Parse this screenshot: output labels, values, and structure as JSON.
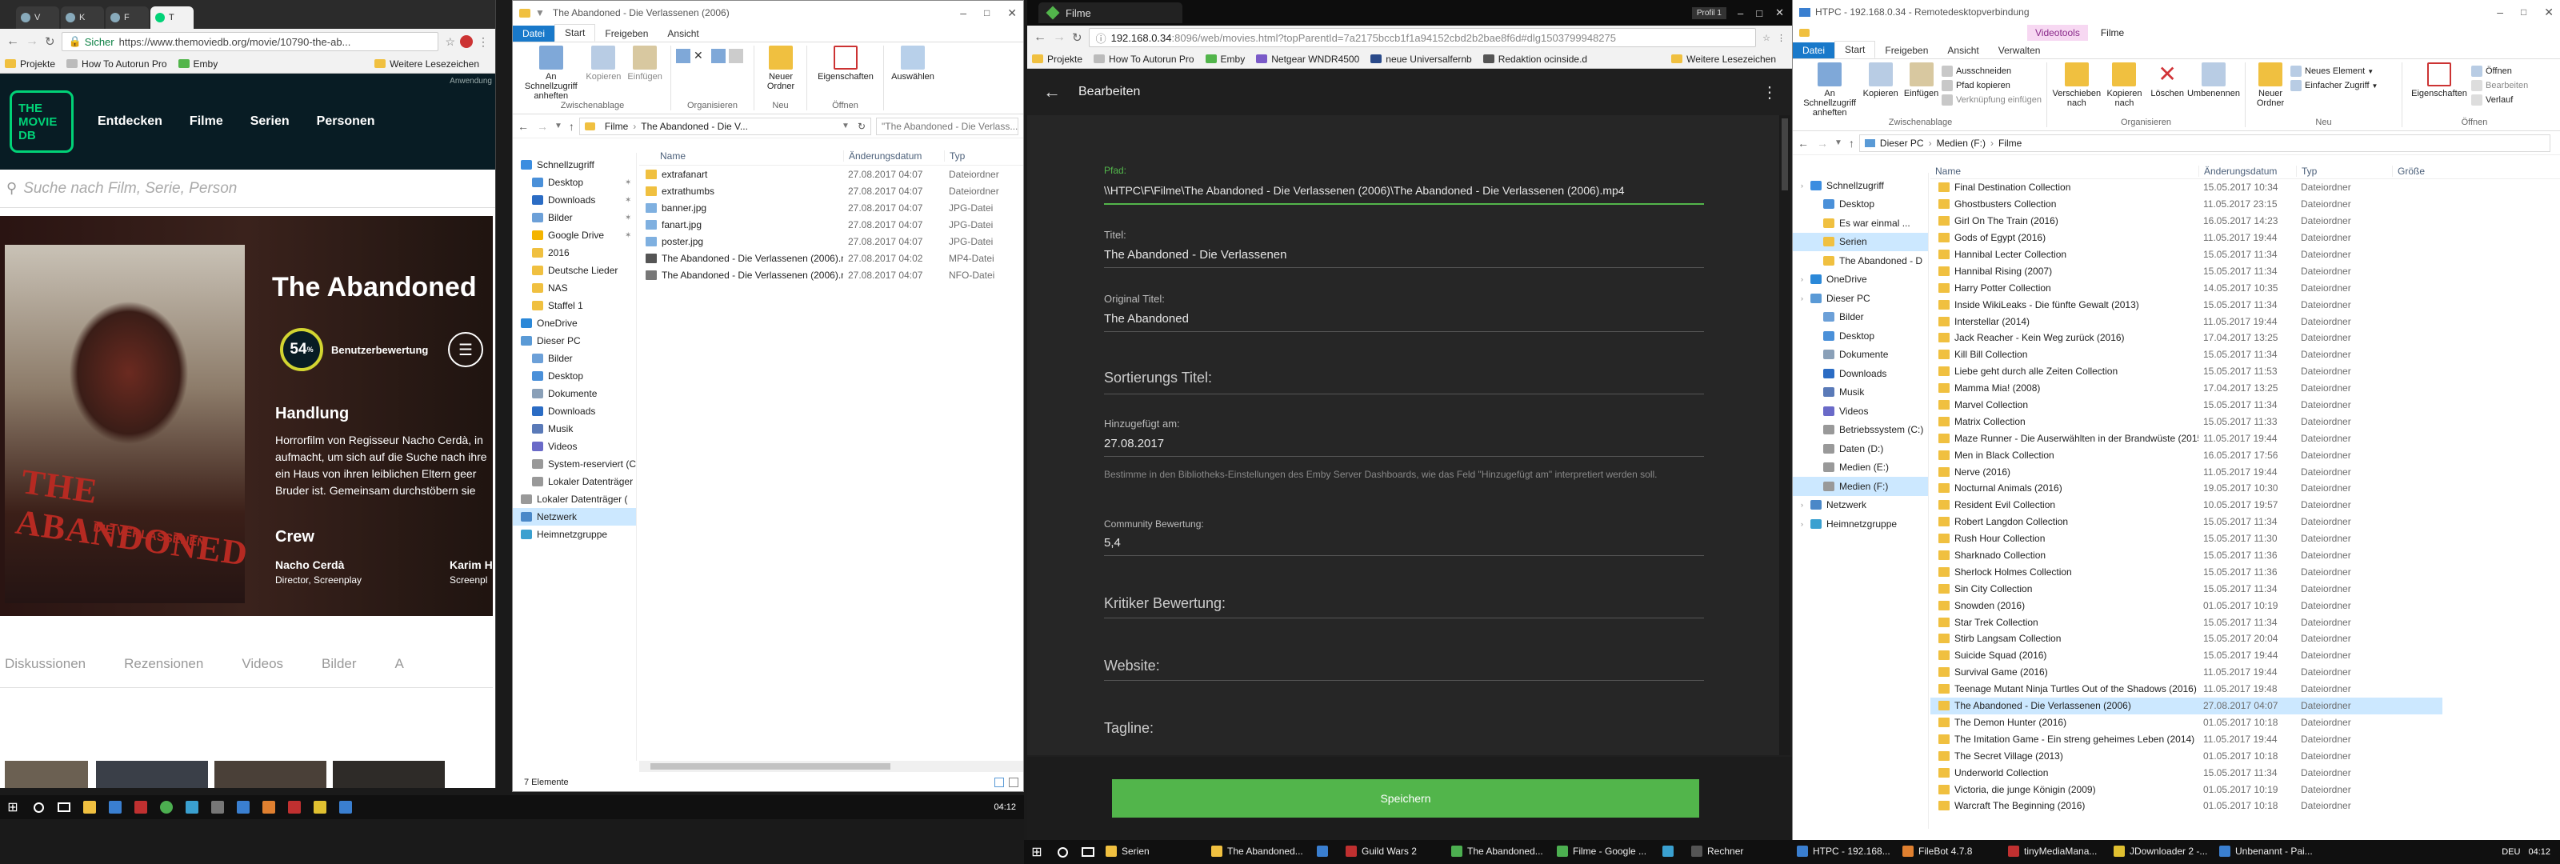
{
  "left_screen": {
    "taskbar": {
      "clock": "04:12"
    }
  },
  "chrome_left": {
    "tabs": [
      "V",
      "K",
      "F",
      "T"
    ],
    "active_tab": "T",
    "url": "https://www.themoviedb.org/movie/10790-the-ab...",
    "secure_label": "Sicher",
    "bookmarks": [
      "Projekte",
      "How To Autorun Pro",
      "Emby"
    ],
    "bookmarks_more": "Weitere Lesezeichen",
    "tmdb": {
      "logo_lines": [
        "THE",
        "MOVIE",
        "DB"
      ],
      "hint": "Anwendung",
      "nav": [
        "Entdecken",
        "Filme",
        "Serien",
        "Personen"
      ],
      "search_placeholder": "Suche nach Film, Serie, Person",
      "title": "The Abandoned",
      "score": "54",
      "score_suffix": "%",
      "score_label": "Benutzerbewertung",
      "plot_heading": "Handlung",
      "plot_text": "Horrorfilm von Regisseur Nacho Cerdà, in aufmacht, um sich auf die Suche nach ihre ein Haus von ihren leiblichen Eltern geer Bruder ist. Gemeinsam durchstöbern sie",
      "poster_title": "THE ABANDONED",
      "poster_sub": "DIE VERLASSENEN",
      "crew_heading": "Crew",
      "crew": [
        {
          "name": "Nacho Cerdà",
          "role": "Director, Screenplay"
        },
        {
          "name": "Karim H",
          "role": "Screenpl"
        }
      ],
      "media_tabs": [
        "Diskussionen",
        "Rezensionen",
        "Videos",
        "Bilder",
        "A"
      ]
    }
  },
  "explorer_left": {
    "title": "The Abandoned - Die Verlassenen (2006)",
    "ribbon_tabs": [
      "Datei",
      "Start",
      "Freigeben",
      "Ansicht"
    ],
    "active_ribbon_tab": "Start",
    "ribbon": {
      "pin_label": "An Schnellzugriff anheften",
      "copy": "Kopieren",
      "paste": "Einfügen",
      "clipboard": "Zwischenablage",
      "organize": "Organisieren",
      "new_folder": "Neuer Ordner",
      "new": "Neu",
      "properties": "Eigenschaften",
      "open": "Öffnen",
      "select": "Auswählen"
    },
    "breadcrumb": [
      "Filme",
      "The Abandoned - Die V..."
    ],
    "search_placeholder": "\"The Abandoned - Die Verlass...",
    "nav": [
      {
        "label": "Schnellzugriff",
        "indent": 0,
        "color": "#3b8de0",
        "pin": false
      },
      {
        "label": "Desktop",
        "indent": 1,
        "color": "#4a90d9",
        "pin": true
      },
      {
        "label": "Downloads",
        "indent": 1,
        "color": "#2b6cc4",
        "pin": true
      },
      {
        "label": "Bilder",
        "indent": 1,
        "color": "#6ca0d8",
        "pin": true
      },
      {
        "label": "Google Drive",
        "indent": 1,
        "color": "#f4b400",
        "pin": true
      },
      {
        "label": "2016",
        "indent": 1,
        "color": "#f0c040",
        "pin": false
      },
      {
        "label": "Deutsche Lieder",
        "indent": 1,
        "color": "#f0c040",
        "pin": false
      },
      {
        "label": "NAS",
        "indent": 1,
        "color": "#f0c040",
        "pin": false
      },
      {
        "label": "Staffel 1",
        "indent": 1,
        "color": "#f0c040",
        "pin": false
      },
      {
        "label": "OneDrive",
        "indent": 0,
        "color": "#2b88d8",
        "pin": false
      },
      {
        "label": "Dieser PC",
        "indent": 0,
        "color": "#5a9ad6",
        "pin": false
      },
      {
        "label": "Bilder",
        "indent": 1,
        "color": "#6ca0d8",
        "pin": false
      },
      {
        "label": "Desktop",
        "indent": 1,
        "color": "#4a90d9",
        "pin": false
      },
      {
        "label": "Dokumente",
        "indent": 1,
        "color": "#8aa0b8",
        "pin": false
      },
      {
        "label": "Downloads",
        "indent": 1,
        "color": "#2b6cc4",
        "pin": false
      },
      {
        "label": "Musik",
        "indent": 1,
        "color": "#5a7ab8",
        "pin": false
      },
      {
        "label": "Videos",
        "indent": 1,
        "color": "#6a6ac8",
        "pin": false
      },
      {
        "label": "System-reserviert (C",
        "indent": 1,
        "color": "#999999",
        "pin": false
      },
      {
        "label": "Lokaler Datenträger",
        "indent": 1,
        "color": "#999999",
        "pin": false
      },
      {
        "label": "Lokaler Datenträger (",
        "indent": 0,
        "color": "#999999",
        "pin": false
      },
      {
        "label": "Netzwerk",
        "indent": 0,
        "color": "#4a88c8",
        "pin": false,
        "selected": true
      },
      {
        "label": "Heimnetzgruppe",
        "indent": 0,
        "color": "#3aa0d0",
        "pin": false
      }
    ],
    "columns": [
      "Name",
      "Änderungsdatum",
      "Typ"
    ],
    "files": [
      {
        "name": "extrafanart",
        "date": "27.08.2017 04:07",
        "type": "Dateiordner",
        "color": "#f0c040"
      },
      {
        "name": "extrathumbs",
        "date": "27.08.2017 04:07",
        "type": "Dateiordner",
        "color": "#f0c040"
      },
      {
        "name": "banner.jpg",
        "date": "27.08.2017 04:07",
        "type": "JPG-Datei",
        "color": "#7fb0e0"
      },
      {
        "name": "fanart.jpg",
        "date": "27.08.2017 04:07",
        "type": "JPG-Datei",
        "color": "#7fb0e0"
      },
      {
        "name": "poster.jpg",
        "date": "27.08.2017 04:07",
        "type": "JPG-Datei",
        "color": "#7fb0e0"
      },
      {
        "name": "The Abandoned - Die Verlassenen (2006).mp4",
        "date": "27.08.2017 04:02",
        "type": "MP4-Datei",
        "color": "#555555"
      },
      {
        "name": "The Abandoned - Die Verlassenen (2006).nfo",
        "date": "27.08.2017 04:07",
        "type": "NFO-Datei",
        "color": "#777777"
      }
    ],
    "status": "7 Elemente"
  },
  "emby": {
    "window_title": "Filme",
    "url_host": "192.168.0.34",
    "url_rest": ":8096/web/movies.html?topParentId=7a2175bccb1f1a94152cbd2b2bae8f6d#dlg1503799948275",
    "bookmarks": [
      "Projekte",
      "How To Autorun Pro",
      "Emby",
      "Netgear WNDR4500",
      "neue Universalfernb",
      "Redaktion ocinside.d"
    ],
    "bookmarks_more": "Weitere Lesezeichen",
    "header_title": "Bearbeiten",
    "profile": "Profil 1",
    "fields": {
      "path_label": "Pfad:",
      "path_value": "\\\\HTPC\\F\\Filme\\The Abandoned - Die Verlassenen (2006)\\The Abandoned - Die Verlassenen (2006).mp4",
      "title_label": "Titel:",
      "title_value": "The Abandoned - Die Verlassenen",
      "orig_label": "Original Titel:",
      "orig_value": "The Abandoned",
      "sort_label": "Sortierungs Titel:",
      "added_label": "Hinzugefügt am:",
      "added_value": "27.08.2017",
      "added_help": "Bestimme in den Bibliotheks-Einstellungen des Emby Server Dashboards, wie das Feld \"Hinzugefügt am\" interpretiert werden soll.",
      "community_label": "Community Bewertung:",
      "community_value": "5,4",
      "critic_label": "Kritiker Bewertung:",
      "website_label": "Website:",
      "tagline_label": "Tagline:"
    },
    "save_button": "Speichern"
  },
  "explorer_right": {
    "title": "HTPC - 192.168.0.34 - Remotedesktopverbindung",
    "context_tab": "Videotools",
    "context_title": "Filme",
    "ribbon_tabs": [
      "Datei",
      "Start",
      "Freigeben",
      "Ansicht",
      "Verwalten"
    ],
    "active_ribbon_tab": "Start",
    "ribbon": {
      "pin_label": "An Schnellzugriff anheften",
      "copy": "Kopieren",
      "paste": "Einfügen",
      "cut": "Ausschneiden",
      "copy_path": "Pfad kopieren",
      "paste_link": "Verknüpfung einfügen",
      "clipboard": "Zwischenablage",
      "move": "Verschieben nach",
      "copyto": "Kopieren nach",
      "delete": "Löschen",
      "rename": "Umbenennen",
      "organize": "Organisieren",
      "new_folder": "Neuer Ordner",
      "new_element": "Neues Element",
      "easy_access": "Einfacher Zugriff",
      "new": "Neu",
      "properties": "Eigenschaften",
      "open": "Öffnen",
      "edit": "Bearbeiten",
      "history": "Verlauf",
      "open_group": "Öffnen"
    },
    "breadcrumb": [
      "Dieser PC",
      "Medien (F:)",
      "Filme"
    ],
    "nav": [
      {
        "label": "Schnellzugriff",
        "indent": 0,
        "color": "#3b8de0"
      },
      {
        "label": "Desktop",
        "indent": 1,
        "color": "#4a90d9"
      },
      {
        "label": "Es war einmal ...",
        "indent": 1,
        "color": "#f0c040"
      },
      {
        "label": "Serien",
        "indent": 1,
        "color": "#f0c040",
        "selected": true
      },
      {
        "label": "The Abandoned - D",
        "indent": 1,
        "color": "#f0c040"
      },
      {
        "label": "OneDrive",
        "indent": 0,
        "color": "#2b88d8"
      },
      {
        "label": "Dieser PC",
        "indent": 0,
        "color": "#5a9ad6"
      },
      {
        "label": "Bilder",
        "indent": 1,
        "color": "#6ca0d8"
      },
      {
        "label": "Desktop",
        "indent": 1,
        "color": "#4a90d9"
      },
      {
        "label": "Dokumente",
        "indent": 1,
        "color": "#8aa0b8"
      },
      {
        "label": "Downloads",
        "indent": 1,
        "color": "#2b6cc4"
      },
      {
        "label": "Musik",
        "indent": 1,
        "color": "#5a7ab8"
      },
      {
        "label": "Videos",
        "indent": 1,
        "color": "#6a6ac8"
      },
      {
        "label": "Betriebssystem (C:)",
        "indent": 1,
        "color": "#999999"
      },
      {
        "label": "Daten (D:)",
        "indent": 1,
        "color": "#999999"
      },
      {
        "label": "Medien (E:)",
        "indent": 1,
        "color": "#999999"
      },
      {
        "label": "Medien (F:)",
        "indent": 1,
        "color": "#999999",
        "selected": true
      },
      {
        "label": "Netzwerk",
        "indent": 0,
        "color": "#4a88c8"
      },
      {
        "label": "Heimnetzgruppe",
        "indent": 0,
        "color": "#3aa0d0"
      }
    ],
    "columns": [
      "Name",
      "Änderungsdatum",
      "Typ",
      "Größe"
    ],
    "files": [
      {
        "name": "Final Destination Collection",
        "date": "15.05.2017 10:34",
        "type": "Dateiordner"
      },
      {
        "name": "Ghostbusters Collection",
        "date": "11.05.2017 23:15",
        "type": "Dateiordner"
      },
      {
        "name": "Girl On The Train (2016)",
        "date": "16.05.2017 14:23",
        "type": "Dateiordner"
      },
      {
        "name": "Gods of Egypt (2016)",
        "date": "11.05.2017 19:44",
        "type": "Dateiordner"
      },
      {
        "name": "Hannibal Lecter Collection",
        "date": "15.05.2017 11:34",
        "type": "Dateiordner"
      },
      {
        "name": "Hannibal Rising (2007)",
        "date": "15.05.2017 11:34",
        "type": "Dateiordner"
      },
      {
        "name": "Harry Potter Collection",
        "date": "14.05.2017 10:35",
        "type": "Dateiordner"
      },
      {
        "name": "Inside WikiLeaks - Die fünfte Gewalt (2013)",
        "date": "15.05.2017 11:34",
        "type": "Dateiordner"
      },
      {
        "name": "Interstellar (2014)",
        "date": "11.05.2017 19:44",
        "type": "Dateiordner"
      },
      {
        "name": "Jack Reacher - Kein Weg zurück (2016)",
        "date": "17.04.2017 13:25",
        "type": "Dateiordner"
      },
      {
        "name": "Kill Bill Collection",
        "date": "15.05.2017 11:34",
        "type": "Dateiordner"
      },
      {
        "name": "Liebe geht durch alle Zeiten Collection",
        "date": "15.05.2017 11:53",
        "type": "Dateiordner"
      },
      {
        "name": "Mamma Mia! (2008)",
        "date": "17.04.2017 13:25",
        "type": "Dateiordner"
      },
      {
        "name": "Marvel Collection",
        "date": "15.05.2017 11:34",
        "type": "Dateiordner"
      },
      {
        "name": "Matrix Collection",
        "date": "15.05.2017 11:33",
        "type": "Dateiordner"
      },
      {
        "name": "Maze Runner - Die Auserwählten in der Brandwüste (2015)",
        "date": "11.05.2017 19:44",
        "type": "Dateiordner"
      },
      {
        "name": "Men in Black Collection",
        "date": "16.05.2017 17:56",
        "type": "Dateiordner"
      },
      {
        "name": "Nerve (2016)",
        "date": "11.05.2017 19:44",
        "type": "Dateiordner"
      },
      {
        "name": "Nocturnal Animals (2016)",
        "date": "19.05.2017 10:30",
        "type": "Dateiordner"
      },
      {
        "name": "Resident Evil Collection",
        "date": "10.05.2017 19:57",
        "type": "Dateiordner"
      },
      {
        "name": "Robert Langdon Collection",
        "date": "15.05.2017 11:34",
        "type": "Dateiordner"
      },
      {
        "name": "Rush Hour Collection",
        "date": "15.05.2017 11:30",
        "type": "Dateiordner"
      },
      {
        "name": "Sharknado Collection",
        "date": "15.05.2017 11:36",
        "type": "Dateiordner"
      },
      {
        "name": "Sherlock Holmes Collection",
        "date": "15.05.2017 11:36",
        "type": "Dateiordner"
      },
      {
        "name": "Sin City Collection",
        "date": "15.05.2017 11:34",
        "type": "Dateiordner"
      },
      {
        "name": "Snowden (2016)",
        "date": "01.05.2017 10:19",
        "type": "Dateiordner"
      },
      {
        "name": "Star Trek Collection",
        "date": "15.05.2017 11:34",
        "type": "Dateiordner"
      },
      {
        "name": "Stirb Langsam Collection",
        "date": "15.05.2017 20:04",
        "type": "Dateiordner"
      },
      {
        "name": "Suicide Squad (2016)",
        "date": "15.05.2017 19:44",
        "type": "Dateiordner"
      },
      {
        "name": "Survival Game (2016)",
        "date": "11.05.2017 19:44",
        "type": "Dateiordner"
      },
      {
        "name": "Teenage Mutant Ninja Turtles Out of the Shadows (2016)",
        "date": "11.05.2017 19:48",
        "type": "Dateiordner"
      },
      {
        "name": "The Abandoned - Die Verlassenen (2006)",
        "date": "27.08.2017 04:07",
        "type": "Dateiordner",
        "selected": true
      },
      {
        "name": "The Demon Hunter (2016)",
        "date": "01.05.2017 10:18",
        "type": "Dateiordner"
      },
      {
        "name": "The Imitation Game - Ein streng geheimes Leben (2014)",
        "date": "11.05.2017 19:44",
        "type": "Dateiordner"
      },
      {
        "name": "The Secret Village (2013)",
        "date": "01.05.2017 10:18",
        "type": "Dateiordner"
      },
      {
        "name": "Underworld Collection",
        "date": "15.05.2017 11:34",
        "type": "Dateiordner"
      },
      {
        "name": "Victoria, die junge Königin (2009)",
        "date": "01.05.2017 10:19",
        "type": "Dateiordner"
      },
      {
        "name": "Warcraft The Beginning (2016)",
        "date": "01.05.2017 10:18",
        "type": "Dateiordner"
      }
    ]
  },
  "right_taskbar": {
    "tasks": [
      {
        "label": "Serien",
        "color": "#f0c040"
      },
      {
        "label": "The Abandoned...",
        "color": "#f0c040"
      },
      {
        "label": "",
        "color": "#3a7fd0"
      },
      {
        "label": "Guild Wars 2",
        "color": "#c03030"
      },
      {
        "label": "The Abandoned...",
        "color": "#4caf50"
      },
      {
        "label": "Filme - Google ...",
        "color": "#4caf50"
      },
      {
        "label": "",
        "color": "#3aa0d0"
      },
      {
        "label": "Rechner",
        "color": "#555555"
      },
      {
        "label": "HTPC - 192.168...",
        "color": "#3a7fd0"
      },
      {
        "label": "FileBot 4.7.8",
        "color": "#e08030"
      },
      {
        "label": "tinyMediaMana...",
        "color": "#c03030"
      },
      {
        "label": "JDownloader 2 -...",
        "color": "#e0c030"
      },
      {
        "label": "Unbenannt - Pai...",
        "color": "#3a7fd0"
      }
    ],
    "lang": "DEU",
    "clock": "04:12"
  }
}
